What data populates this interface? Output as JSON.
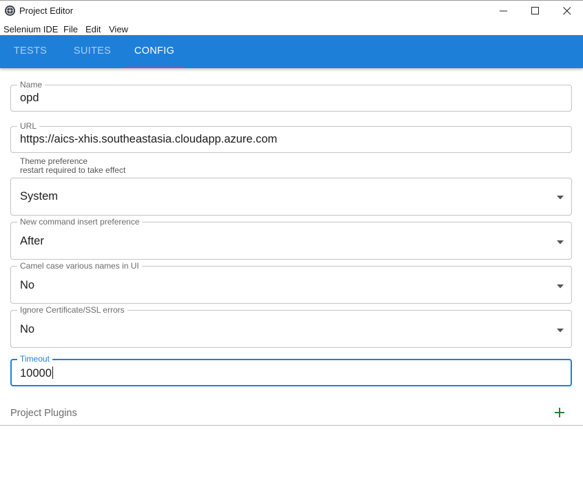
{
  "window": {
    "title": "Project Editor",
    "icon": "selenium-ide-app-icon",
    "controls": [
      "minimize-icon",
      "maximize-icon",
      "close-icon"
    ]
  },
  "menu": {
    "items": [
      "Selenium IDE",
      "File",
      "Edit",
      "View"
    ]
  },
  "tabs": {
    "items": [
      {
        "label": "TESTS",
        "active": false
      },
      {
        "label": "SUITES",
        "active": false
      },
      {
        "label": "CONFIG",
        "active": true
      }
    ],
    "indicator_color": "#d02fae",
    "bar_color": "#1e7fd8"
  },
  "config": {
    "name": {
      "label": "Name",
      "value": "opd"
    },
    "url": {
      "label": "URL",
      "value": "https://aics-xhis.southeastasia.cloudapp.azure.com"
    },
    "theme": {
      "label": "Theme preference",
      "hint": "restart required to take effect",
      "value": "System"
    },
    "command_insert": {
      "label": "New command insert preference",
      "value": "After"
    },
    "camel_case": {
      "label": "Camel case various names in UI",
      "value": "No"
    },
    "ignore_ssl": {
      "label": "Ignore Certificate/SSL errors",
      "value": "No"
    },
    "timeout": {
      "label": "Timeout",
      "value": "10000",
      "focused": true
    }
  },
  "plugins": {
    "label": "Project Plugins",
    "add_icon": "plus-icon",
    "add_icon_color": "#2e7d32"
  }
}
